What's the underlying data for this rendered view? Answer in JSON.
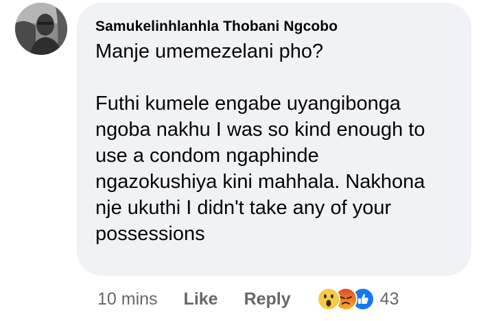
{
  "comment": {
    "author": "Samukelinhlanhla Thobani Ngcobo",
    "paragraphs": [
      "Manje umemezelani pho?",
      "Futhi kumele engabe uyangibonga ngoba nakhu I was so kind enough to use a condom ngaphinde ngazokushiya kini mahhala. Nakhona nje ukuthi I didn't take any of your possessions"
    ],
    "lines_p2": [
      "Futhi kumele engabe uyangibonga",
      "ngoba nakhu I was so kind enough to",
      "use a condom ngaphinde",
      "ngazokushiya kini mahhala. Nakhona",
      "nje ukuthi I didn't take any of your",
      "possessions"
    ]
  },
  "actions": {
    "time": "10 mins",
    "like_label": "Like",
    "reply_label": "Reply",
    "reaction_count": "43",
    "reactions": [
      "wow-icon",
      "angry-icon",
      "like-icon"
    ]
  },
  "colors": {
    "bubble": "#f0f2f5",
    "text": "#050505",
    "secondary": "#65676b",
    "like_blue": "#1877f2",
    "wow_yellow": "#f7c945",
    "angry_red": "#e9710f"
  }
}
